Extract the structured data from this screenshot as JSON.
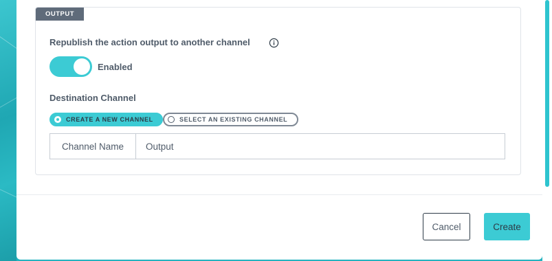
{
  "output_section": {
    "tag": "OUTPUT",
    "republish_label": "Republish the action output to another channel",
    "toggle_state_label": "Enabled",
    "toggle_on": true,
    "destination_label": "Destination Channel",
    "radio_options": [
      {
        "label": "CREATE A NEW CHANNEL",
        "selected": true
      },
      {
        "label": "SELECT AN EXISTING CHANNEL",
        "selected": false
      }
    ],
    "channel_name_label": "Channel Name",
    "channel_name_value": "Output"
  },
  "footer": {
    "cancel_label": "Cancel",
    "create_label": "Create"
  },
  "colors": {
    "accent": "#3ccbd4",
    "tag_bg": "#5f6b7a",
    "text": "#4f5b69",
    "background": "#23b3bf"
  },
  "icons": {
    "info": "info-icon",
    "radio_selected": "radio-selected-icon",
    "radio_unselected": "radio-unselected-icon"
  }
}
